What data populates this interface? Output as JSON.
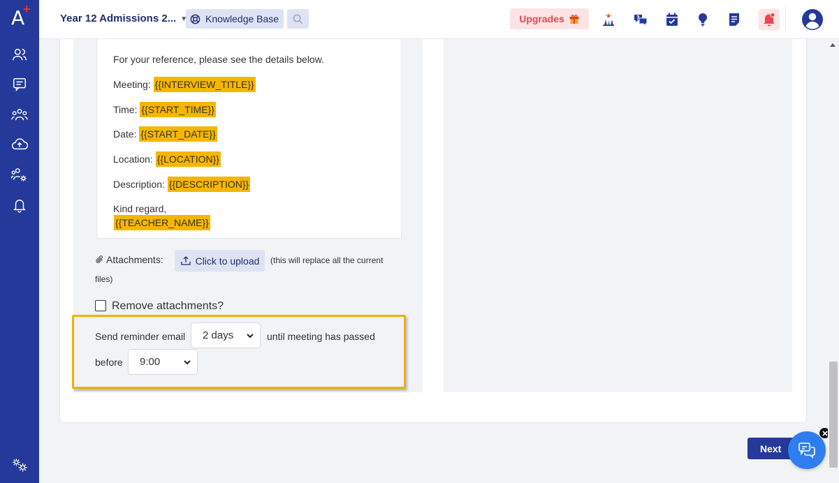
{
  "sidebar": {
    "logo_letter": "A",
    "logo_plus": "+",
    "items": [
      {
        "icon": "users-icon"
      },
      {
        "icon": "message-icon"
      },
      {
        "icon": "group-icon"
      },
      {
        "icon": "cloud-upload-icon"
      },
      {
        "icon": "user-settings-icon"
      },
      {
        "icon": "bell-icon"
      }
    ],
    "settings_icon": "settings-icon"
  },
  "topbar": {
    "title": "Year 12 Admissions 2...",
    "knowledge_base": "Knowledge Base",
    "upgrades": "Upgrades",
    "colors": {
      "brand": "#24399a",
      "upgrade": "#e8474f",
      "highlight": "#f6b600"
    }
  },
  "email": {
    "reference_line": "For your reference, please see the details below.",
    "meeting_label": "Meeting:",
    "meeting_tag": "{{INTERVIEW_TITLE}}",
    "time_label": "Time:",
    "time_tag": "{{START_TIME}}",
    "date_label": "Date:",
    "date_tag": "{{START_DATE}}",
    "location_label": "Location:",
    "location_tag": "{{LOCATION}}",
    "description_label": "Description:",
    "description_tag": "{{DESCRIPTION}}",
    "closing": "Kind regard,",
    "teacher_tag": "{{TEACHER_NAME}}"
  },
  "attachments": {
    "label": "Attachments:",
    "upload_button": "Click to upload",
    "note_part1": "(this will replace all the current",
    "note_part2": "files)",
    "remove_label": "Remove attachments?",
    "remove_checked": false
  },
  "reminder": {
    "send_label": "Send reminder email",
    "days_value": "2 days",
    "until_label": "until meeting has passed",
    "before_label": "before",
    "time_value": "9:00"
  },
  "footer": {
    "next_button": "Next"
  }
}
